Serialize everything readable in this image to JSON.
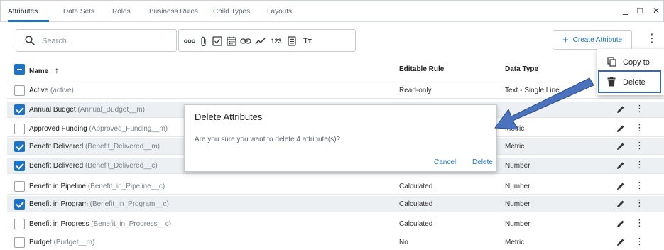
{
  "tabs": [
    {
      "label": "Attributes",
      "active": true
    },
    {
      "label": "Data Sets",
      "active": false
    },
    {
      "label": "Roles",
      "active": false
    },
    {
      "label": "Business Rules",
      "active": false
    },
    {
      "label": "Child Types",
      "active": false
    },
    {
      "label": "Layouts",
      "active": false
    }
  ],
  "window": {
    "minimize": "_",
    "maximize": "□",
    "close": "✕"
  },
  "toolbar": {
    "search_placeholder": "Search...",
    "number_icon_text": "123",
    "text_icon_text": "Tт",
    "create_label": "Create Attribute",
    "more": "⋮"
  },
  "table": {
    "headers": {
      "name": "Name",
      "sort": "↑",
      "rule": "Editable Rule",
      "type": "Data Type"
    },
    "rows": [
      {
        "name": "Active",
        "api": "(active)",
        "rule": "Read-only",
        "type": "Text - Single Line",
        "checked": false
      },
      {
        "name": "Annual Budget",
        "api": "(Annual_Budget__m)",
        "rule": "",
        "type": "",
        "checked": true
      },
      {
        "name": "Approved Funding",
        "api": "(Approved_Funding__m)",
        "rule": "",
        "type": "Metric",
        "checked": false
      },
      {
        "name": "Benefit Delivered",
        "api": "(Benefit_Delivered__m)",
        "rule": "",
        "type": "Metric",
        "checked": true
      },
      {
        "name": "Benefit Delivered",
        "api": "(Benefit_Delivered__c)",
        "rule": "",
        "type": "Number",
        "checked": true
      },
      {
        "name": "Benefit in Pipeline",
        "api": "(Benefit_in_Pipeline__c)",
        "rule": "Calculated",
        "type": "Number",
        "checked": false
      },
      {
        "name": "Benefit in Program",
        "api": "(Benefit_in_Program__c)",
        "rule": "Calculated",
        "type": "Number",
        "checked": true
      },
      {
        "name": "Benefit in Progress",
        "api": "(Benefit_in_Progress__c)",
        "rule": "Calculated",
        "type": "Number",
        "checked": false
      },
      {
        "name": "Budget",
        "api": "(Budget__m)",
        "rule": "No",
        "type": "Metric",
        "checked": false
      }
    ],
    "more": "⋮"
  },
  "dialog": {
    "title": "Delete Attributes",
    "message": "Are you sure you want to delete 4 attribute(s)?",
    "cancel": "Cancel",
    "delete": "Delete"
  },
  "context_menu": {
    "items": [
      {
        "label": "Copy to",
        "icon": "copy-icon"
      },
      {
        "label": "Delete",
        "icon": "trash-icon"
      }
    ]
  },
  "colors": {
    "accent": "#1a73c8",
    "highlight": "#3568b8",
    "selected_row": "#edf0f3"
  }
}
